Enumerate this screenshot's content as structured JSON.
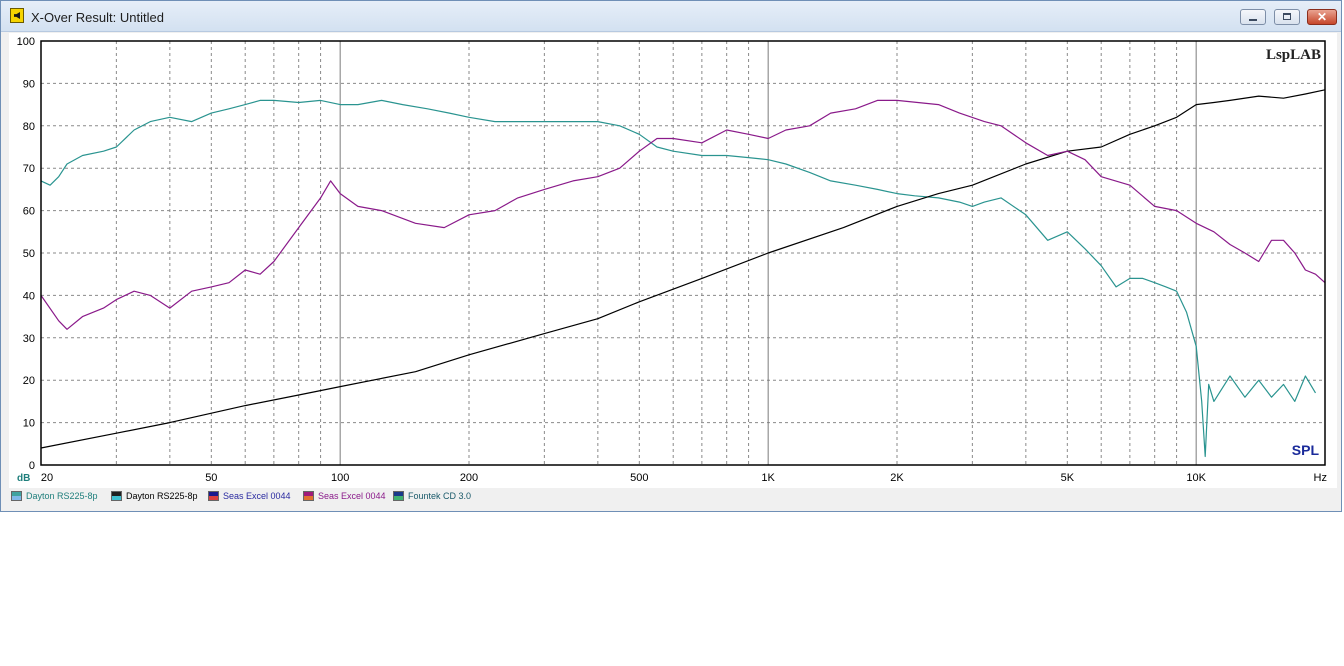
{
  "window": {
    "title": "X-Over Result: Untitled",
    "icon": "speaker-icon",
    "buttons": {
      "minimize": "minimize-icon",
      "maximize": "maximize-icon",
      "close_glyph": "✕"
    }
  },
  "chart_data": {
    "type": "line",
    "xscale": "log",
    "xlim": [
      20,
      20000
    ],
    "ylim": [
      0,
      100
    ],
    "grid": true,
    "brand": "LspLAB",
    "plot_label": "SPL",
    "ylabel": "dB",
    "xlabel": "Hz",
    "y_ticks": [
      "0",
      "10",
      "20",
      "30",
      "40",
      "50",
      "60",
      "70",
      "80",
      "90",
      "100"
    ],
    "x_ticks": [
      {
        "value": 20,
        "label": "20"
      },
      {
        "value": 50,
        "label": "50"
      },
      {
        "value": 100,
        "label": "100"
      },
      {
        "value": 200,
        "label": "200"
      },
      {
        "value": 500,
        "label": "500"
      },
      {
        "value": 1000,
        "label": "1K"
      },
      {
        "value": 2000,
        "label": "2K"
      },
      {
        "value": 5000,
        "label": "5K"
      },
      {
        "value": 10000,
        "label": "10K"
      }
    ],
    "series": [
      {
        "name": "Dayton RS225-8p",
        "color": "#2a9490",
        "points": [
          [
            20,
            67
          ],
          [
            21,
            66
          ],
          [
            22,
            68
          ],
          [
            23,
            71
          ],
          [
            25,
            73
          ],
          [
            28,
            74
          ],
          [
            30,
            75
          ],
          [
            33,
            79
          ],
          [
            36,
            81
          ],
          [
            40,
            82
          ],
          [
            45,
            81
          ],
          [
            50,
            83
          ],
          [
            55,
            84
          ],
          [
            60,
            85
          ],
          [
            65,
            86
          ],
          [
            70,
            86
          ],
          [
            80,
            85.5
          ],
          [
            90,
            86
          ],
          [
            100,
            85
          ],
          [
            110,
            85
          ],
          [
            125,
            86
          ],
          [
            140,
            85
          ],
          [
            160,
            84
          ],
          [
            180,
            83
          ],
          [
            200,
            82
          ],
          [
            230,
            81
          ],
          [
            260,
            81
          ],
          [
            300,
            81
          ],
          [
            350,
            81
          ],
          [
            400,
            81
          ],
          [
            450,
            80
          ],
          [
            500,
            78
          ],
          [
            550,
            75
          ],
          [
            600,
            74
          ],
          [
            700,
            73
          ],
          [
            800,
            73
          ],
          [
            900,
            72.5
          ],
          [
            1000,
            72
          ],
          [
            1100,
            71
          ],
          [
            1250,
            69
          ],
          [
            1400,
            67
          ],
          [
            1600,
            66
          ],
          [
            1800,
            65
          ],
          [
            2000,
            64
          ],
          [
            2200,
            63.5
          ],
          [
            2500,
            63
          ],
          [
            2800,
            62
          ],
          [
            3000,
            61
          ],
          [
            3200,
            62
          ],
          [
            3500,
            63
          ],
          [
            4000,
            59
          ],
          [
            4500,
            53
          ],
          [
            5000,
            55
          ],
          [
            5500,
            51
          ],
          [
            6000,
            47
          ],
          [
            6500,
            42
          ],
          [
            7000,
            44
          ],
          [
            7500,
            44
          ],
          [
            8000,
            43
          ],
          [
            8500,
            42
          ],
          [
            9000,
            41
          ],
          [
            9500,
            36
          ],
          [
            10000,
            28
          ],
          [
            10300,
            15
          ],
          [
            10500,
            2
          ],
          [
            10700,
            19
          ],
          [
            11000,
            15
          ],
          [
            12000,
            21
          ],
          [
            13000,
            16
          ],
          [
            14000,
            20
          ],
          [
            15000,
            16
          ],
          [
            16000,
            19
          ],
          [
            17000,
            15
          ],
          [
            18000,
            21
          ],
          [
            19000,
            17
          ]
        ]
      },
      {
        "name": "Dayton RS225-8p",
        "color": "#000000",
        "points": [
          [
            20,
            4
          ],
          [
            30,
            7.5
          ],
          [
            40,
            10
          ],
          [
            60,
            14
          ],
          [
            80,
            16.5
          ],
          [
            100,
            18.5
          ],
          [
            150,
            22
          ],
          [
            200,
            26
          ],
          [
            300,
            31
          ],
          [
            400,
            34.5
          ],
          [
            500,
            38.5
          ],
          [
            700,
            44
          ],
          [
            1000,
            50
          ],
          [
            1500,
            56
          ],
          [
            2000,
            61
          ],
          [
            2500,
            64
          ],
          [
            3000,
            66
          ],
          [
            4000,
            71
          ],
          [
            5000,
            74
          ],
          [
            6000,
            75
          ],
          [
            7000,
            78
          ],
          [
            8000,
            80
          ],
          [
            9000,
            82
          ],
          [
            10000,
            85
          ],
          [
            11000,
            85.5
          ],
          [
            12000,
            86
          ],
          [
            14000,
            87
          ],
          [
            16000,
            86.5
          ],
          [
            18000,
            87.5
          ],
          [
            20000,
            88.5
          ]
        ]
      },
      {
        "name": "Seas Excel 0044",
        "color": "#2a2abf",
        "points": []
      },
      {
        "name": "Seas Excel 0044",
        "color": "#8a1a8a",
        "points": [
          [
            20,
            40
          ],
          [
            22,
            34
          ],
          [
            23,
            32
          ],
          [
            25,
            35
          ],
          [
            28,
            37
          ],
          [
            30,
            39
          ],
          [
            33,
            41
          ],
          [
            36,
            40
          ],
          [
            40,
            37
          ],
          [
            45,
            41
          ],
          [
            50,
            42
          ],
          [
            55,
            43
          ],
          [
            60,
            46
          ],
          [
            65,
            45
          ],
          [
            70,
            48
          ],
          [
            80,
            56
          ],
          [
            90,
            63
          ],
          [
            95,
            67
          ],
          [
            100,
            64
          ],
          [
            110,
            61
          ],
          [
            125,
            60
          ],
          [
            150,
            57
          ],
          [
            175,
            56
          ],
          [
            200,
            59
          ],
          [
            230,
            60
          ],
          [
            260,
            63
          ],
          [
            300,
            65
          ],
          [
            350,
            67
          ],
          [
            400,
            68
          ],
          [
            450,
            70
          ],
          [
            500,
            74
          ],
          [
            550,
            77
          ],
          [
            600,
            77
          ],
          [
            700,
            76
          ],
          [
            800,
            79
          ],
          [
            900,
            78
          ],
          [
            1000,
            77
          ],
          [
            1100,
            79
          ],
          [
            1250,
            80
          ],
          [
            1400,
            83
          ],
          [
            1600,
            84
          ],
          [
            1800,
            86
          ],
          [
            2000,
            86
          ],
          [
            2500,
            85
          ],
          [
            2800,
            83
          ],
          [
            3200,
            81
          ],
          [
            3500,
            80
          ],
          [
            4000,
            76
          ],
          [
            4500,
            73
          ],
          [
            5000,
            74
          ],
          [
            5500,
            72
          ],
          [
            6000,
            68
          ],
          [
            7000,
            66
          ],
          [
            8000,
            61
          ],
          [
            9000,
            60
          ],
          [
            10000,
            57
          ],
          [
            11000,
            55
          ],
          [
            12000,
            52
          ],
          [
            13000,
            50
          ],
          [
            14000,
            48
          ],
          [
            15000,
            53
          ],
          [
            16000,
            53
          ],
          [
            17000,
            50
          ],
          [
            18000,
            46
          ],
          [
            19000,
            45
          ],
          [
            20000,
            43
          ]
        ]
      },
      {
        "name": "Fountek CD 3.0",
        "color": "#1a6a5a",
        "points": []
      }
    ]
  },
  "legend": [
    {
      "label": "Dayton RS225-8p",
      "swatch_top": "#3fa39f",
      "swatch_bottom": "#7fb8e8",
      "text_color": "#1f7f7c"
    },
    {
      "label": "Dayton RS225-8p",
      "swatch_top": "#202020",
      "swatch_bottom": "#40c0d0",
      "text_color": "#000000"
    },
    {
      "label": "Seas Excel 0044",
      "swatch_top": "#1a1a8f",
      "swatch_bottom": "#d84040",
      "text_color": "#2a2aa0"
    },
    {
      "label": "Seas Excel 0044",
      "swatch_top": "#a01a7a",
      "swatch_bottom": "#e07030",
      "text_color": "#8a1a8a"
    },
    {
      "label": "Fountek CD 3.0",
      "swatch_top": "#1a3a8a",
      "swatch_bottom": "#40b070",
      "text_color": "#1a5a6a"
    }
  ]
}
